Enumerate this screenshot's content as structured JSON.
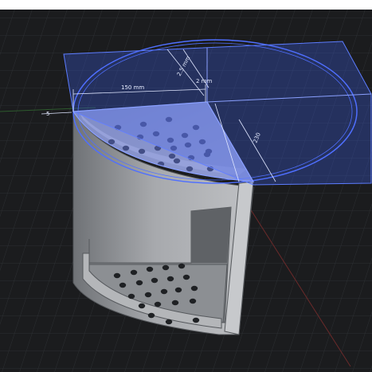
{
  "viewport": {
    "name": "3D CAD viewport",
    "background": "#1b1c1e",
    "grid_color": "#2c2f33",
    "selection_color": "#3a5ad6"
  },
  "dimensions": {
    "width_label": "150 mm",
    "radius_label": "2.5 mm",
    "side_label": "2 mm",
    "diag_label": "230",
    "left_label": "5"
  },
  "model": {
    "type": "quarter-circle perforated shelf caddy",
    "body_color": "#9a9ca0",
    "hole_color": "#1f2124"
  }
}
